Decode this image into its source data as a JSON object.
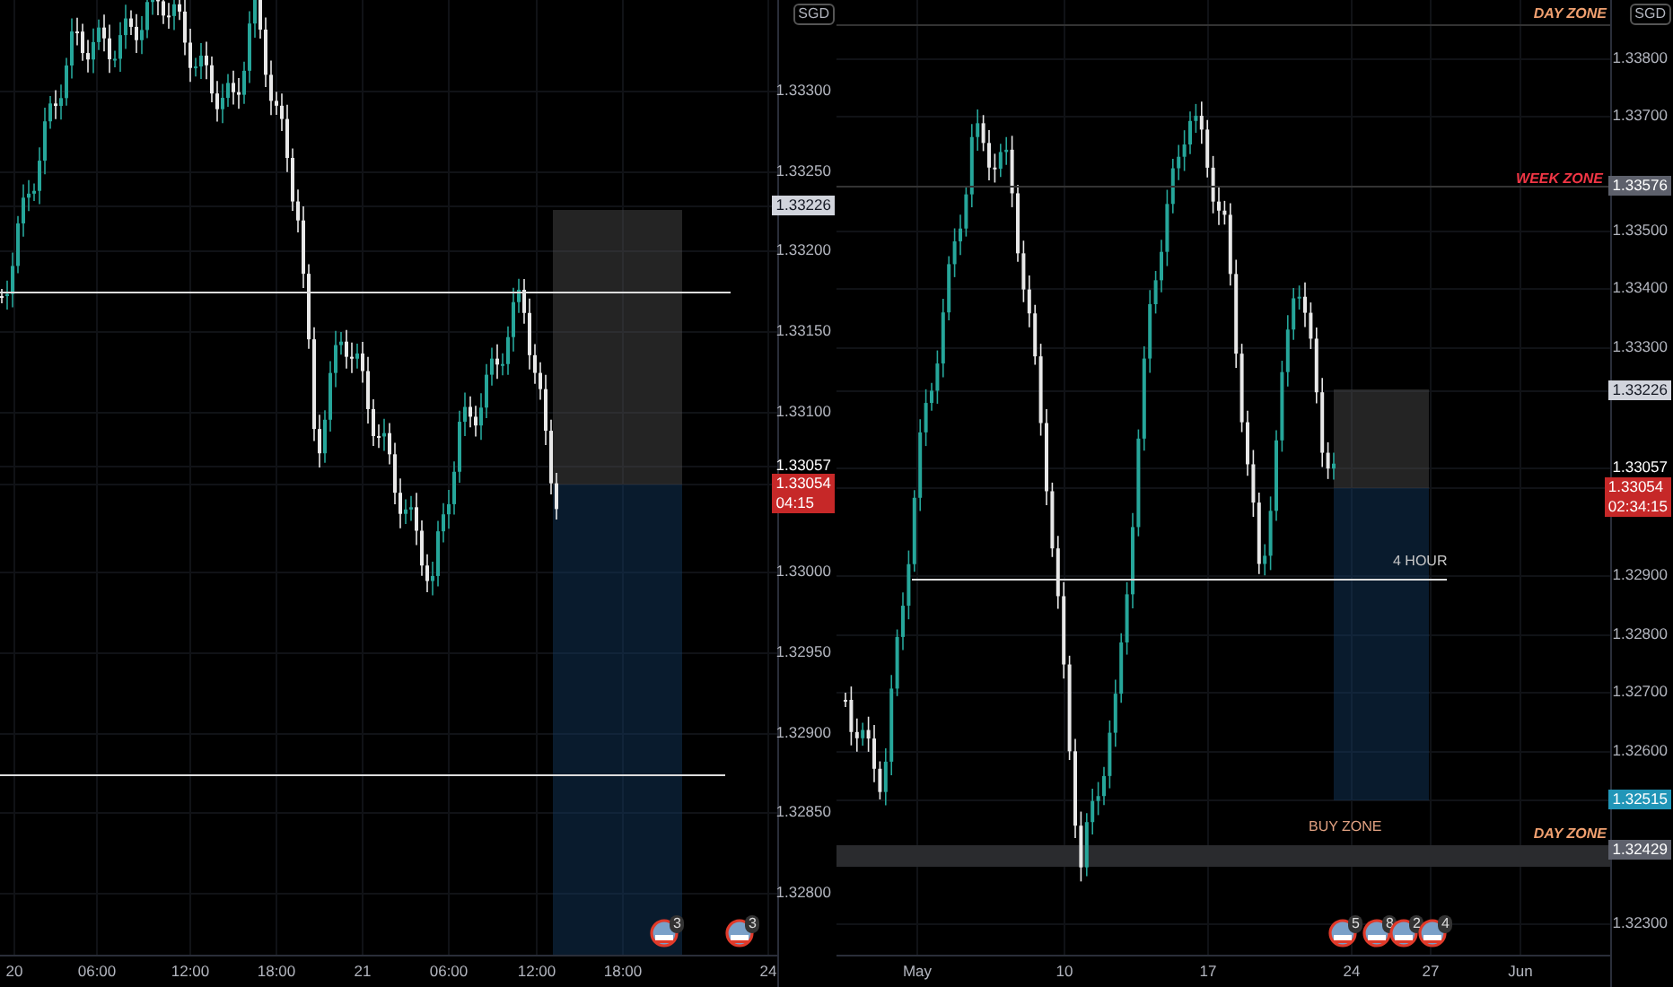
{
  "panes": [
    {
      "currency": "SGD",
      "price_axis": [
        {
          "text": "1.33300",
          "kind": "tick"
        },
        {
          "text": "1.33250",
          "kind": "tick"
        },
        {
          "text": "1.33226",
          "kind": "level"
        },
        {
          "text": "1.33200",
          "kind": "tick"
        },
        {
          "text": "1.33150",
          "kind": "tick"
        },
        {
          "text": "1.33100",
          "kind": "tick"
        },
        {
          "text": "1.33057",
          "kind": "high"
        },
        {
          "text": "1.33054",
          "kind": "last",
          "countdown": "04:15"
        },
        {
          "text": "1.33000",
          "kind": "tick"
        },
        {
          "text": "1.32950",
          "kind": "tick"
        },
        {
          "text": "1.32900",
          "kind": "tick"
        },
        {
          "text": "1.32850",
          "kind": "tick"
        },
        {
          "text": "1.32800",
          "kind": "tick"
        }
      ],
      "time_axis": [
        "20",
        "06:00",
        "12:00",
        "18:00",
        "21",
        "06:00",
        "12:00",
        "18:00",
        "24"
      ],
      "events": [
        {
          "count": "3"
        },
        {
          "count": "3"
        }
      ]
    },
    {
      "currency": "SGD",
      "price_axis": [
        {
          "text": "1.33800",
          "kind": "tick"
        },
        {
          "text": "1.33700",
          "kind": "tick"
        },
        {
          "text": "1.33576",
          "kind": "zone"
        },
        {
          "text": "1.33500",
          "kind": "tick"
        },
        {
          "text": "1.33400",
          "kind": "tick"
        },
        {
          "text": "1.33300",
          "kind": "tick"
        },
        {
          "text": "1.33226",
          "kind": "level"
        },
        {
          "text": "1.33057",
          "kind": "high"
        },
        {
          "text": "1.33054",
          "kind": "last",
          "countdown": "02:34:15"
        },
        {
          "text": "1.32900",
          "kind": "tick"
        },
        {
          "text": "1.32800",
          "kind": "tick"
        },
        {
          "text": "1.32700",
          "kind": "tick"
        },
        {
          "text": "1.32600",
          "kind": "tick"
        },
        {
          "text": "1.32515",
          "kind": "target"
        },
        {
          "text": "1.32429",
          "kind": "zone"
        },
        {
          "text": "1.32300",
          "kind": "tick"
        }
      ],
      "time_axis": [
        "May",
        "10",
        "17",
        "24",
        "27",
        "Jun"
      ],
      "annotations": [
        {
          "text": "DAY ZONE",
          "color": "#f0a070"
        },
        {
          "text": "WEEK ZONE",
          "color": "#f23645"
        },
        {
          "text": "4 HOUR",
          "color": "#c8c8c8"
        },
        {
          "text": "BUY ZONE",
          "color": "#e0a080"
        },
        {
          "text": "DAY ZONE",
          "color": "#f0a070"
        }
      ],
      "events": [
        {
          "count": "5"
        },
        {
          "count": "8"
        },
        {
          "count": "2"
        },
        {
          "count": "4"
        }
      ]
    }
  ]
}
